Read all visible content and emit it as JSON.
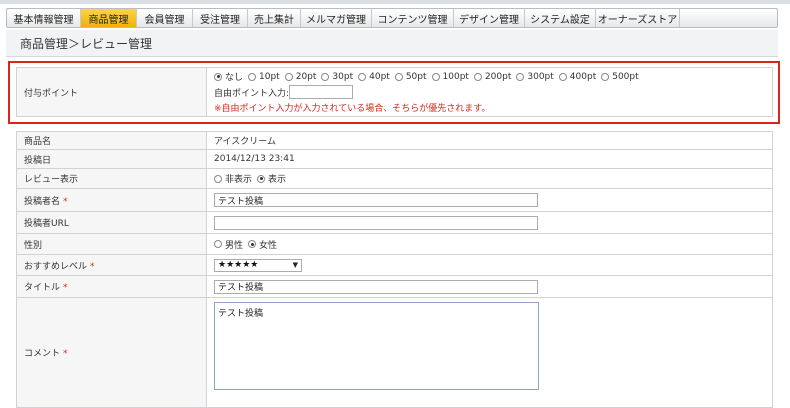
{
  "nav": {
    "items": [
      {
        "label": "基本情報管理",
        "active": false
      },
      {
        "label": "商品管理",
        "active": true
      },
      {
        "label": "会員管理",
        "active": false
      },
      {
        "label": "受注管理",
        "active": false
      },
      {
        "label": "売上集計",
        "active": false
      },
      {
        "label": "メルマガ管理",
        "active": false
      },
      {
        "label": "コンテンツ管理",
        "active": false
      },
      {
        "label": "デザイン管理",
        "active": false
      },
      {
        "label": "システム設定",
        "active": false
      },
      {
        "label": "オーナーズストア",
        "active": false
      }
    ]
  },
  "page": {
    "title": "商品管理＞レビュー管理"
  },
  "point": {
    "label": "付与ポイント",
    "options": [
      "なし",
      "10pt",
      "20pt",
      "30pt",
      "40pt",
      "50pt",
      "100pt",
      "200pt",
      "300pt",
      "400pt",
      "500pt"
    ],
    "selected": "なし",
    "free_label": "自由ポイント入力:",
    "free_value": "",
    "note": "※自由ポイント入力が入力されている場合、そちらが優先されます。"
  },
  "form": {
    "product_name": {
      "label": "商品名",
      "value": "アイスクリーム"
    },
    "post_date": {
      "label": "投稿日",
      "value": "2014/12/13 23:41"
    },
    "review_display": {
      "label": "レビュー表示",
      "options": [
        "非表示",
        "表示"
      ],
      "selected": "表示"
    },
    "poster_name": {
      "label": "投稿者名",
      "required": "*",
      "value": "テスト投稿"
    },
    "poster_url": {
      "label": "投稿者URL",
      "value": ""
    },
    "gender": {
      "label": "性別",
      "options": [
        "男性",
        "女性"
      ],
      "selected": "女性"
    },
    "recommend": {
      "label": "おすすめレベル",
      "required": "*",
      "value": "★★★★★"
    },
    "title": {
      "label": "タイトル",
      "required": "*",
      "value": "テスト投稿"
    },
    "comment": {
      "label": "コメント",
      "required": "*",
      "value": "テスト投稿"
    }
  },
  "colors": {
    "accent": "#eeb10c",
    "required": "#d7261d",
    "highlight_border": "#d7261d"
  }
}
